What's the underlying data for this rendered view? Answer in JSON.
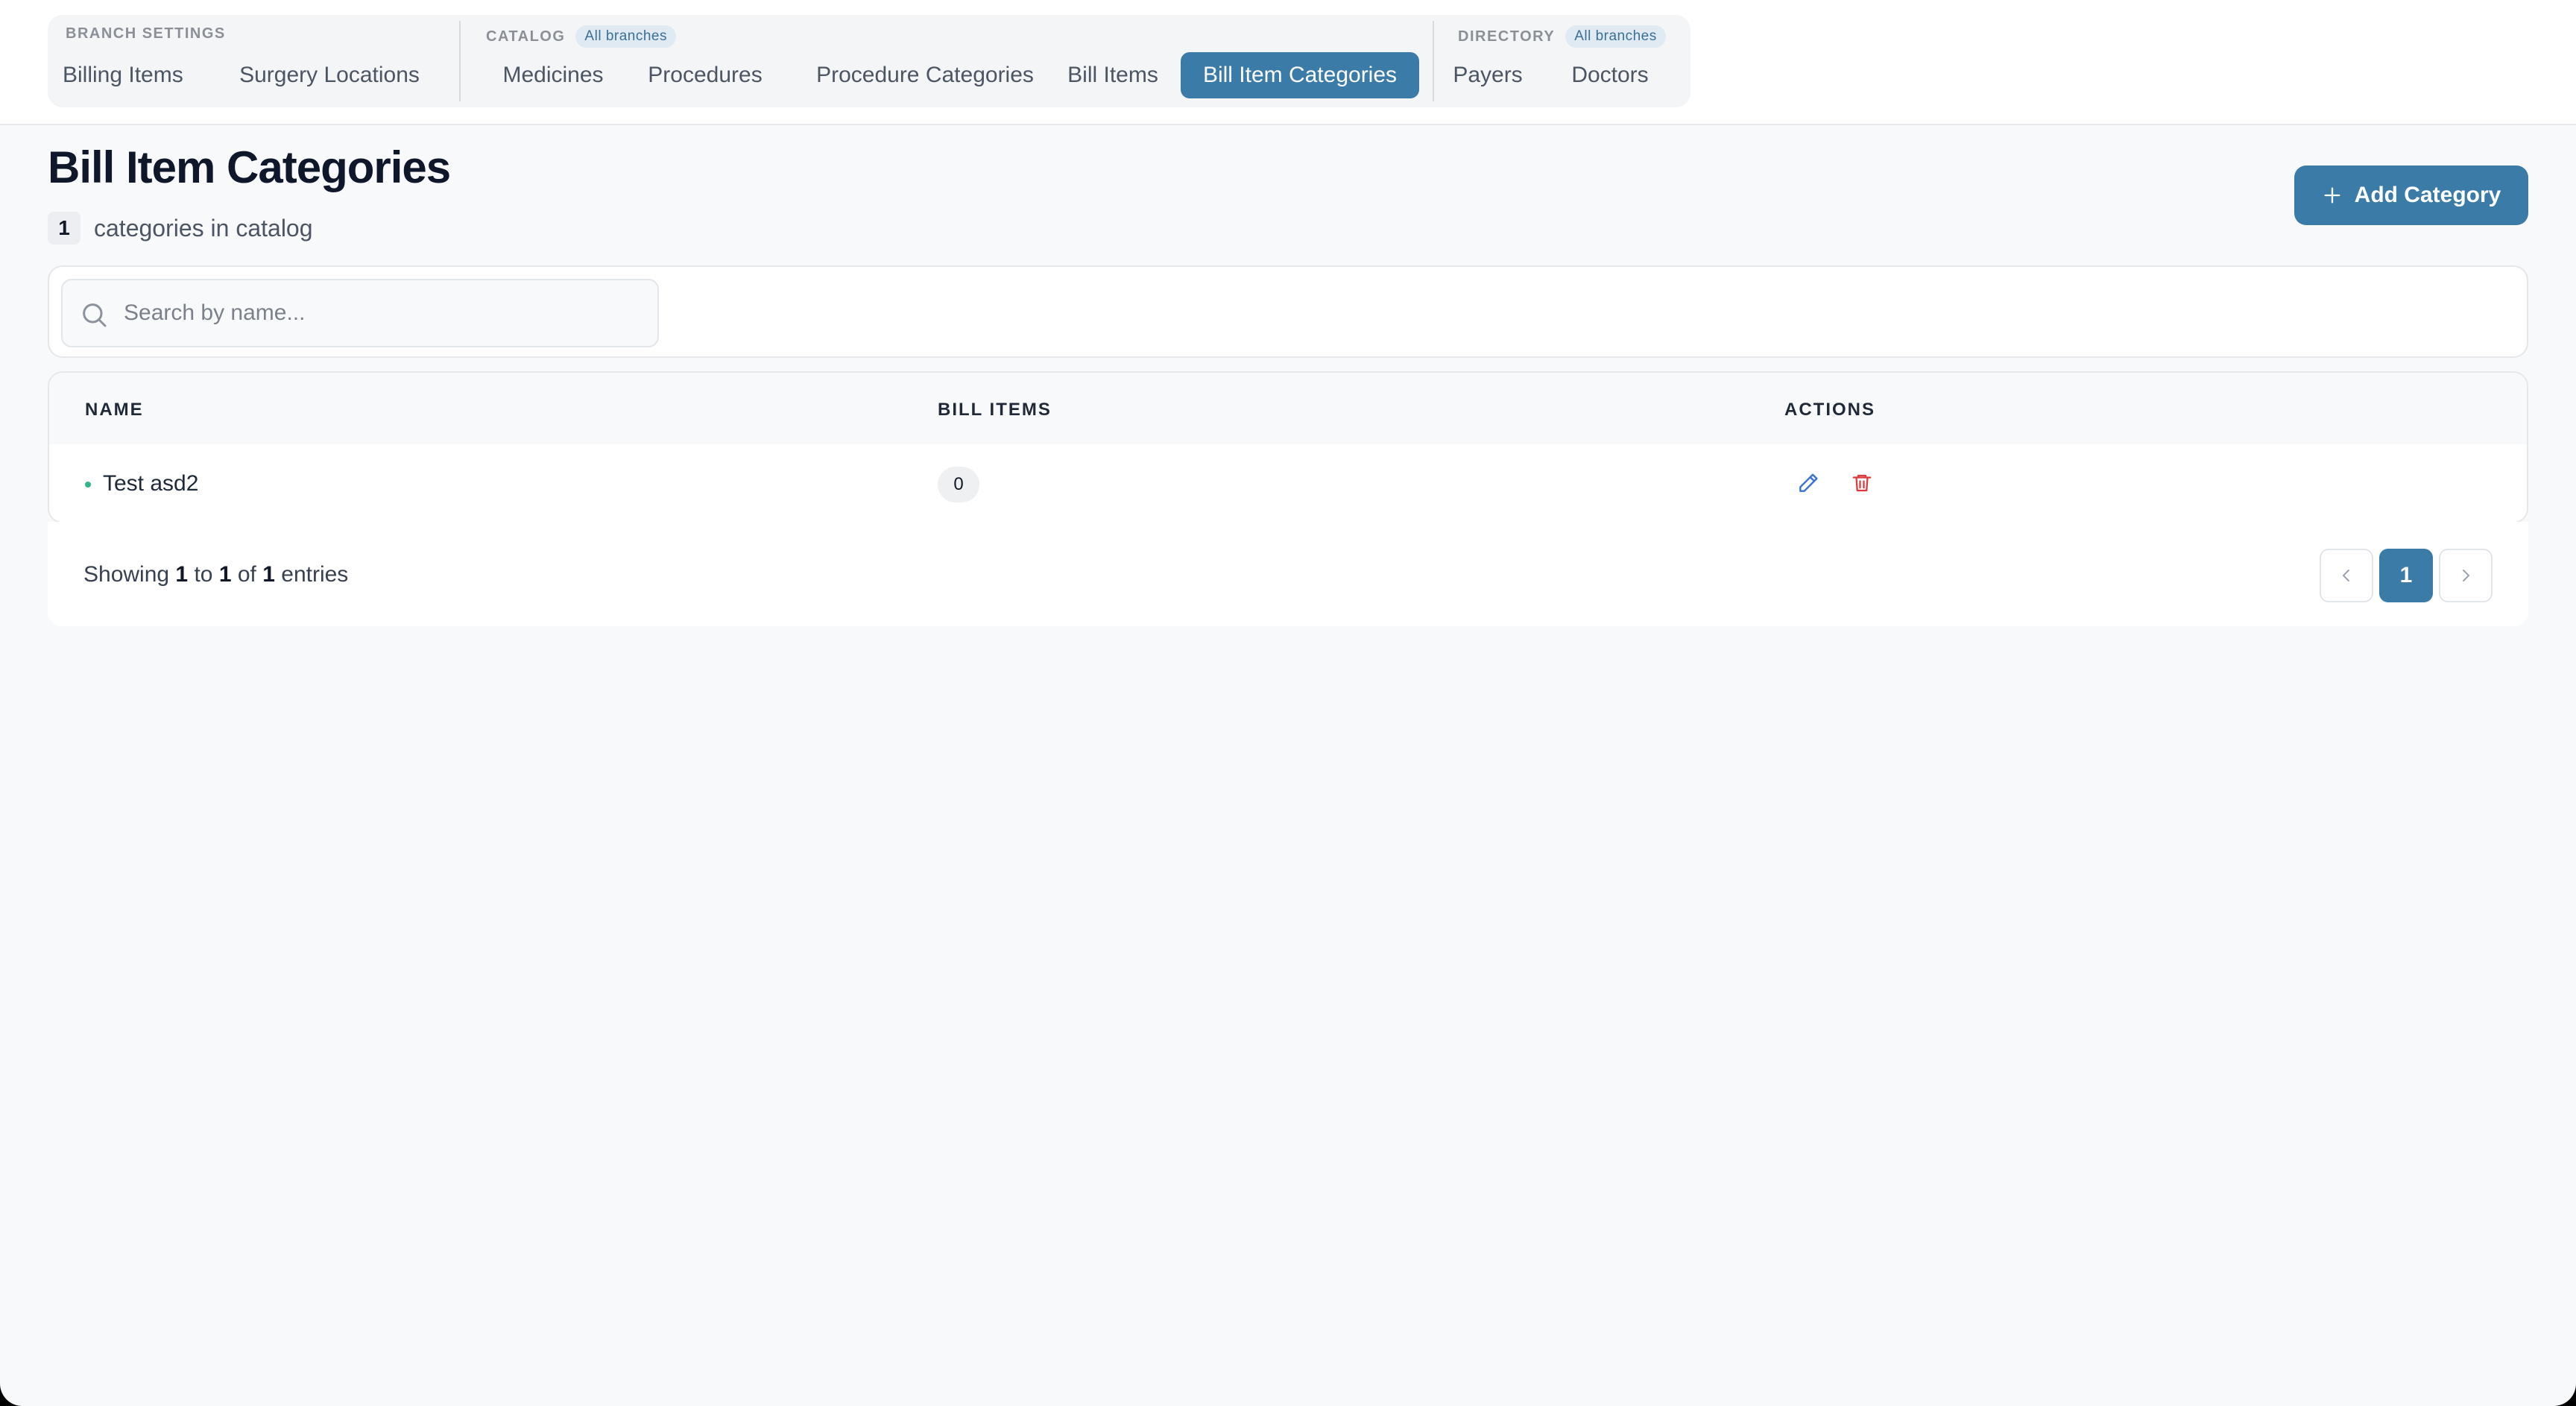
{
  "nav": {
    "branch_settings": {
      "heading": "BRANCH SETTINGS",
      "tabs": [
        "Billing Items",
        "Surgery Locations"
      ]
    },
    "catalog": {
      "heading": "CATALOG",
      "badge": "All branches",
      "tabs": [
        "Medicines",
        "Procedures",
        "Procedure Categories",
        "Bill Items",
        "Bill Item Categories"
      ]
    },
    "directory": {
      "heading": "DIRECTORY",
      "badge": "All branches",
      "tabs": [
        "Payers",
        "Doctors"
      ]
    },
    "active_tab": "Bill Item Categories"
  },
  "header": {
    "title": "Bill Item Categories",
    "count": "1",
    "count_label": "categories in catalog",
    "add_button": "Add Category"
  },
  "search": {
    "placeholder": "Search by name...",
    "value": ""
  },
  "table": {
    "columns": [
      "NAME",
      "BILL ITEMS",
      "ACTIONS"
    ],
    "rows": [
      {
        "name": "Test asd2",
        "bill_items": "0"
      }
    ]
  },
  "pagination": {
    "prefix": "Showing",
    "from": "1",
    "to_word": "to",
    "to": "1",
    "of_word": "of",
    "total": "1",
    "suffix": "entries",
    "current_page": "1"
  },
  "colors": {
    "accent": "#3b7ba8",
    "edit_icon": "#3b6fd4",
    "delete_icon": "#dc3b3b",
    "status_dot": "#34b38a"
  }
}
